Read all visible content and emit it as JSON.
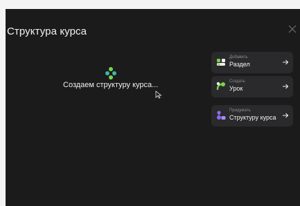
{
  "dialog": {
    "title": "Структура курса"
  },
  "loading": {
    "text": "Создаем структуру курса..."
  },
  "actions": [
    {
      "hint": "Добавить",
      "label": "Раздел",
      "icon": "section-icon"
    },
    {
      "hint": "Создать",
      "label": "Урок",
      "icon": "lesson-icon"
    },
    {
      "hint": "Придумать",
      "label": "Структуру курса",
      "icon": "structure-icon"
    }
  ],
  "colors": {
    "background": "#1b1b1c",
    "card": "#2a2a2c",
    "accent_green": "#7bd34a",
    "accent_purple": "#8a6cf0"
  }
}
